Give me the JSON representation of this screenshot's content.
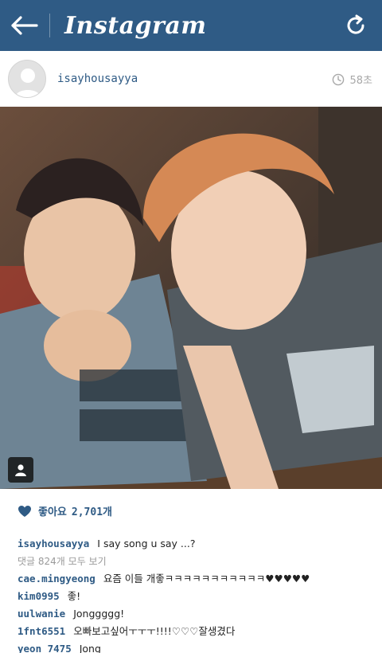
{
  "topbar": {
    "title": "Instagram",
    "back_icon": "arrow-left-icon",
    "refresh_icon": "refresh-icon",
    "background": "#2f5b85"
  },
  "post": {
    "username": "isayhousayya",
    "time": "58초",
    "likes_label": "좋아요",
    "likes_count": "2,701개",
    "caption_user": "isayhousayya",
    "caption_text": "I say song u say ...?",
    "view_all_comments": "댓글 824개 모두 보기"
  },
  "comments": [
    {
      "user": "cae.mingyeong",
      "text": "요즘 이들 개좋ㅋㅋㅋㅋㅋㅋㅋㅋㅋㅋㅋ♥♥♥♥♥"
    },
    {
      "user": "kim0995",
      "text": "좋!"
    },
    {
      "user": "uulwanie",
      "text": "Jonggggg!"
    },
    {
      "user": "1fnt6551",
      "text": "오빠보고싶어ㅜㅜㅜ!!!!♡♡♡잘생겼다"
    },
    {
      "user": "yeon_7475",
      "text": "Jong"
    }
  ],
  "colors": {
    "accent": "#2f5b85",
    "muted": "#9a9a9a"
  }
}
